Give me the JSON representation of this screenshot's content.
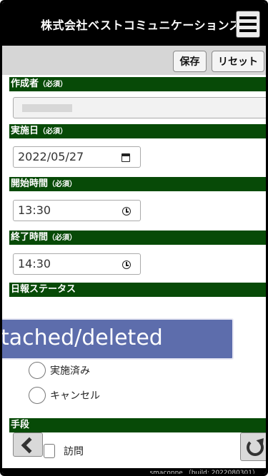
{
  "header": {
    "title": "株式会社ベストコミュニケーションズ"
  },
  "toolbar": {
    "save_label": "保存",
    "reset_label": "リセット"
  },
  "sections": {
    "author": {
      "label": "作成者",
      "required": "（必須）"
    },
    "date": {
      "label": "実施日",
      "required": "（必須）"
    },
    "start": {
      "label": "開始時間",
      "required": "（必須）"
    },
    "end": {
      "label": "終了時間",
      "required": "（必須）"
    },
    "status": {
      "label": "日報ステータス"
    },
    "method": {
      "label": "手段"
    }
  },
  "fields": {
    "date_value": "2022/05/27",
    "start_value": "13:30",
    "end_value": "14:30"
  },
  "toast": {
    "text": "tached/deleted"
  },
  "status_options": [
    "実施済み",
    "キャンセル"
  ],
  "method_options": [
    "訪問"
  ],
  "footer": {
    "build": "smaconne （build: 2022080301）"
  },
  "colors": {
    "section_bg": "#074a07",
    "toast_bg": "#5d6dac"
  }
}
